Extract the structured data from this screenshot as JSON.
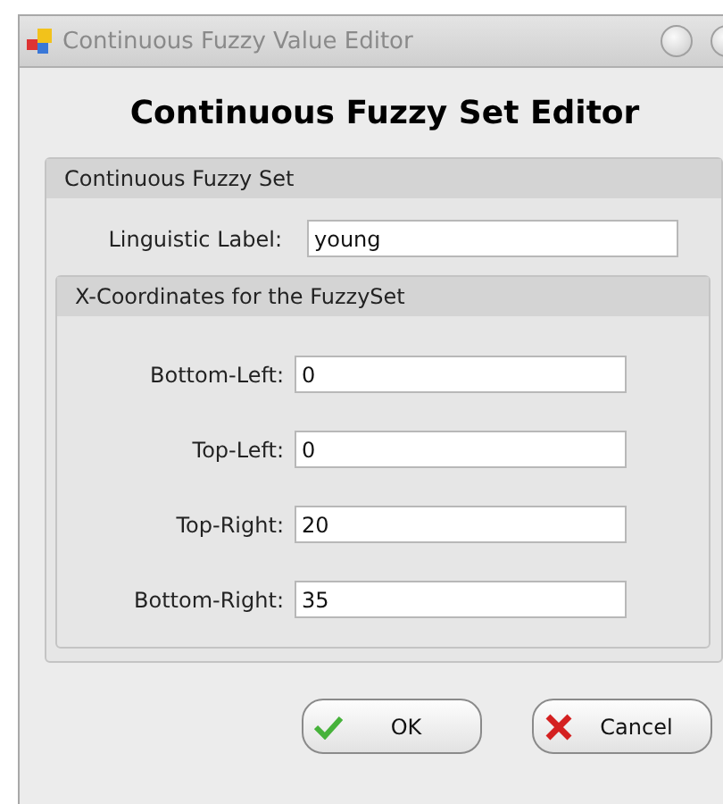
{
  "window": {
    "title": "Continuous Fuzzy Value Editor"
  },
  "heading": "Continuous Fuzzy Set Editor",
  "set_group": {
    "title": "Continuous Fuzzy Set",
    "label": "Linguistic Label:",
    "value": "young"
  },
  "coordinates_group": {
    "title": "X-Coordinates for the FuzzySet",
    "fields": [
      {
        "label": "Bottom-Left:",
        "value": "0"
      },
      {
        "label": "Top-Left:",
        "value": "0"
      },
      {
        "label": "Top-Right:",
        "value": "20"
      },
      {
        "label": "Bottom-Right:",
        "value": "35"
      }
    ]
  },
  "buttons": [
    {
      "kind": "ok",
      "label": "OK"
    },
    {
      "kind": "cancel",
      "label": "Cancel"
    }
  ]
}
